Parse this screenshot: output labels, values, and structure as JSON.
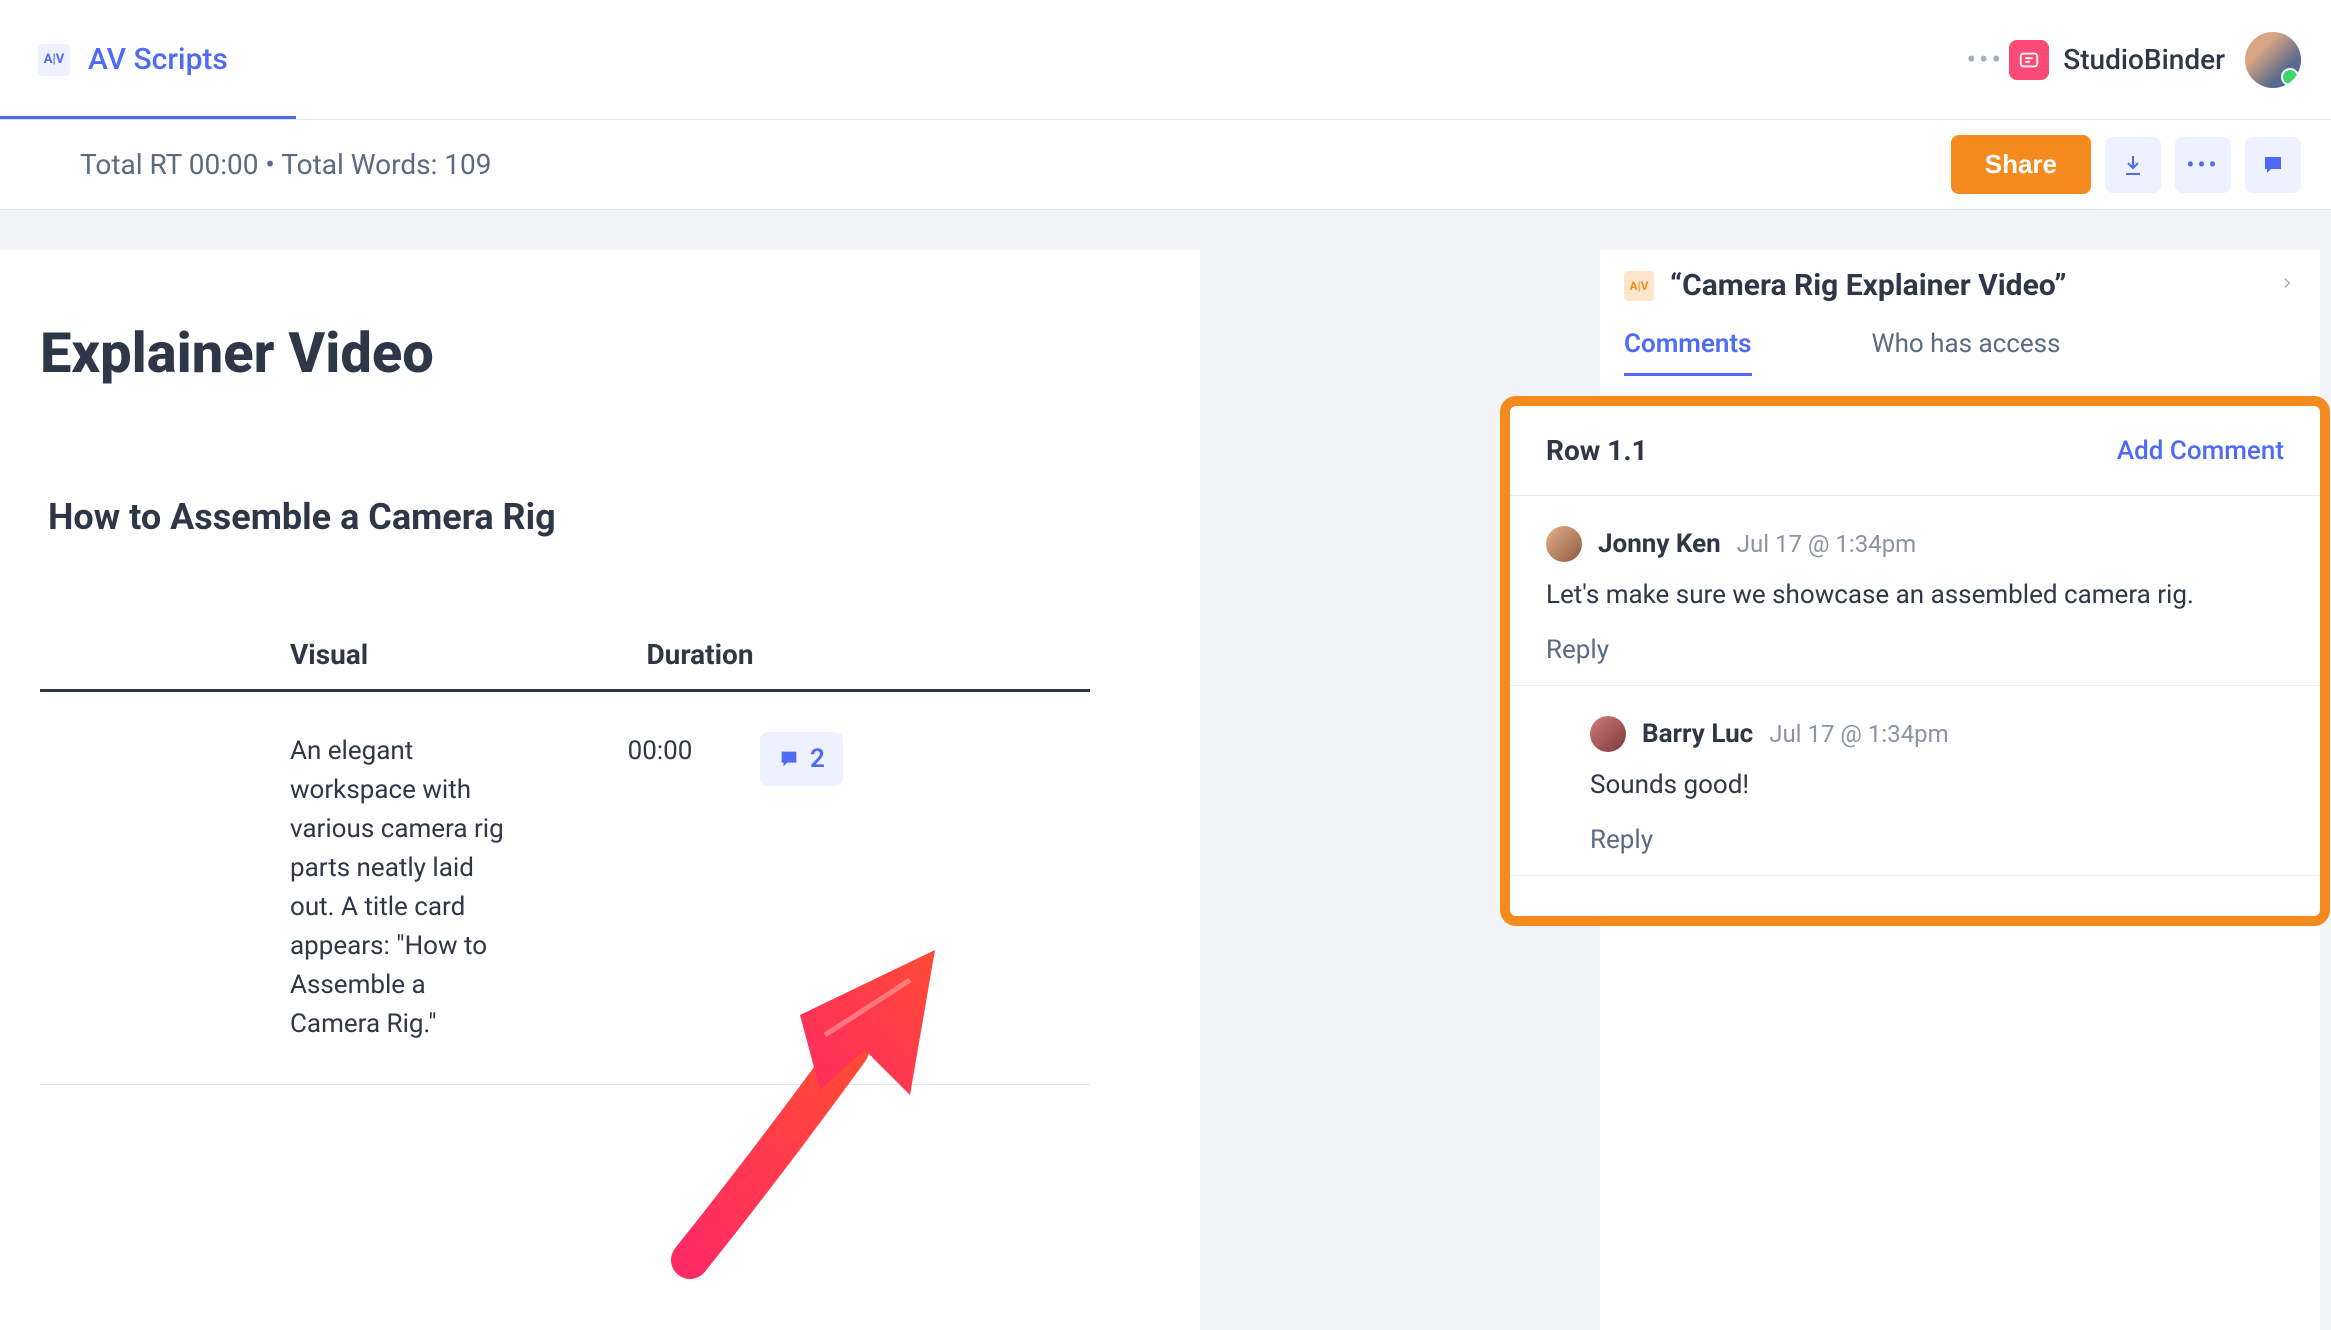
{
  "nav": {
    "tab_label": "AV Scripts",
    "brand_name": "StudioBinder"
  },
  "toolbar": {
    "stats": "Total RT 00:00 • Total Words: 109",
    "share_label": "Share"
  },
  "doc": {
    "title": "Explainer Video",
    "subtitle": "How to Assemble a Camera Rig",
    "columns": {
      "visual": "Visual",
      "duration": "Duration"
    },
    "row": {
      "visual": "An elegant workspace with various camera rig parts neatly laid out. A title card appears: \"How to Assemble a Camera Rig.\"",
      "duration": "00:00",
      "comment_count": "2"
    }
  },
  "side": {
    "title": "“Camera Rig Explainer Video”",
    "tabs": {
      "comments": "Comments",
      "access": "Who has access"
    },
    "row_label": "Row 1.1",
    "add_comment": "Add Comment",
    "comments": [
      {
        "author": "Jonny Ken",
        "date": "Jul 17 @ 1:34pm",
        "body": "Let's make sure we showcase an assembled camera rig.",
        "reply_label": "Reply"
      },
      {
        "author": "Barry Luc",
        "date": "Jul 17 @ 1:34pm",
        "body": "Sounds good!",
        "reply_label": "Reply"
      }
    ]
  }
}
